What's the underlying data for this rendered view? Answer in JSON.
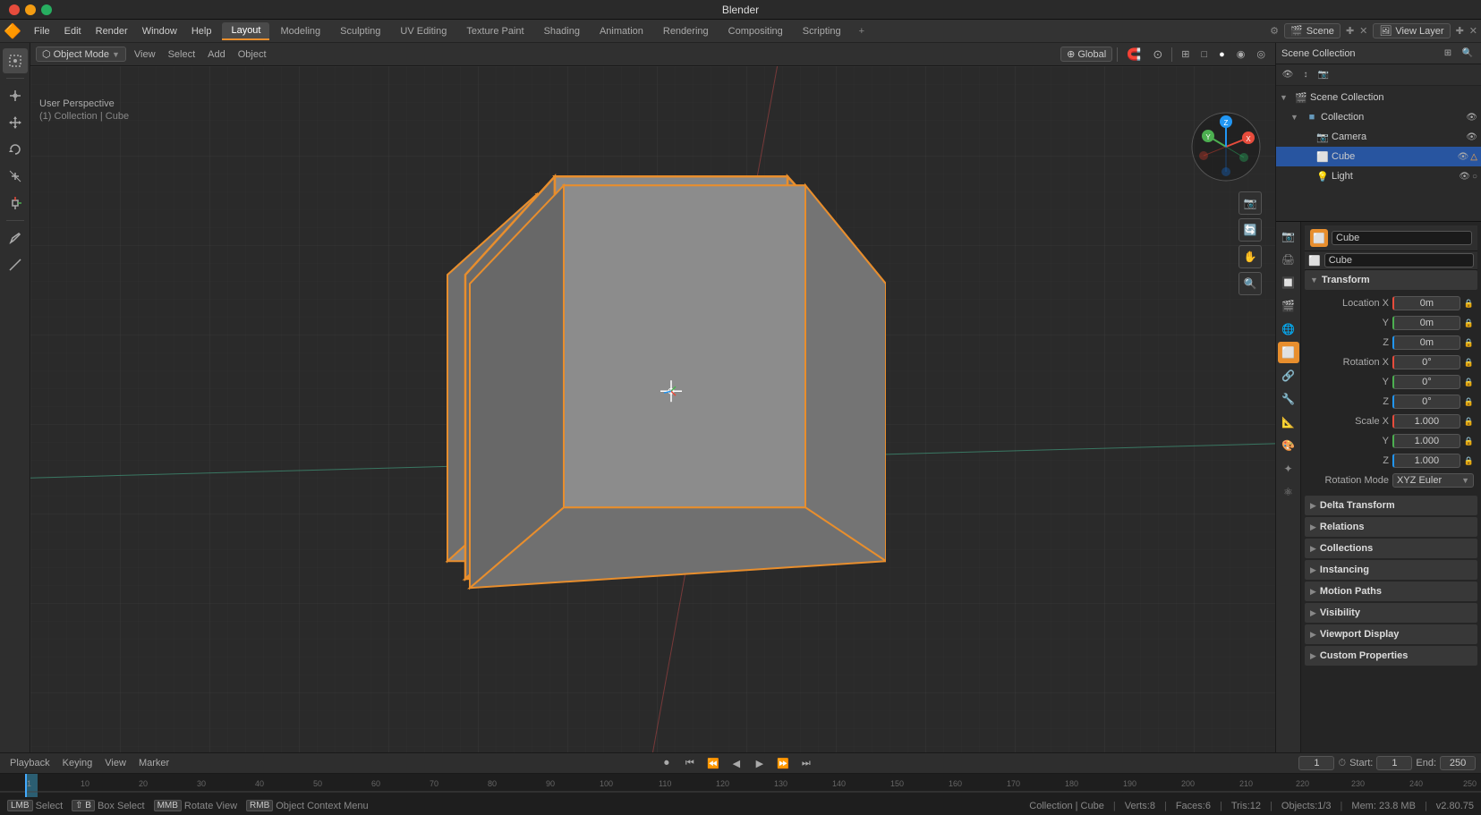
{
  "window": {
    "title": "Blender",
    "controls": [
      "close",
      "minimize",
      "maximize"
    ]
  },
  "menubar": {
    "menus": [
      "File",
      "Edit",
      "Render",
      "Window",
      "Help"
    ],
    "workspaces": [
      {
        "label": "Layout",
        "active": true
      },
      {
        "label": "Modeling"
      },
      {
        "label": "Sculpting"
      },
      {
        "label": "UV Editing"
      },
      {
        "label": "Texture Paint"
      },
      {
        "label": "Shading"
      },
      {
        "label": "Animation"
      },
      {
        "label": "Rendering"
      },
      {
        "label": "Compositing"
      },
      {
        "label": "Scripting"
      }
    ],
    "plus_label": "+",
    "scene_label": "Scene",
    "view_layer_label": "View Layer"
  },
  "viewport_header": {
    "mode": "Object Mode",
    "view": "View",
    "select": "Select",
    "add": "Add",
    "object": "Object",
    "transform": "Global"
  },
  "viewport": {
    "label1": "User Perspective",
    "label2": "(1) Collection | Cube"
  },
  "outliner": {
    "title": "Scene Collection",
    "items": [
      {
        "name": "Scene Collection",
        "level": 0,
        "expanded": true,
        "icon": "📁",
        "type": "collection"
      },
      {
        "name": "Collection",
        "level": 1,
        "expanded": true,
        "icon": "📂",
        "type": "collection"
      },
      {
        "name": "Camera",
        "level": 2,
        "icon": "📷",
        "type": "camera",
        "selected": false
      },
      {
        "name": "Cube",
        "level": 2,
        "icon": "⬜",
        "type": "mesh",
        "selected": true
      },
      {
        "name": "Light",
        "level": 2,
        "icon": "💡",
        "type": "light",
        "selected": false
      }
    ]
  },
  "properties": {
    "object_name": "Cube",
    "sections": {
      "transform_title": "Transform",
      "location_label": "Location",
      "location_x": "0m",
      "location_y": "0m",
      "location_z": "0m",
      "rotation_label": "Rotation",
      "rotation_x": "0°",
      "rotation_y": "0°",
      "rotation_z": "0°",
      "scale_label": "Scale",
      "scale_x": "1.000",
      "scale_y": "1.000",
      "scale_z": "1.000",
      "rotation_mode_label": "Rotation Mode",
      "rotation_mode_value": "XYZ Euler",
      "delta_transform": "Delta Transform",
      "relations": "Relations",
      "collections": "Collections",
      "instancing": "Instancing",
      "motion_paths": "Motion Paths",
      "visibility": "Visibility",
      "viewport_display": "Viewport Display",
      "custom_properties": "Custom Properties"
    }
  },
  "timeline": {
    "frame_current": "1",
    "frame_start": "1",
    "frame_end": "250",
    "start_label": "Start:",
    "end_label": "End:",
    "playback_label": "Playback",
    "keying_label": "Keying",
    "view_label": "View",
    "marker_label": "Marker",
    "marks": [
      "1",
      "10",
      "20",
      "30",
      "40",
      "50",
      "60",
      "70",
      "80",
      "90",
      "100",
      "110",
      "120",
      "130",
      "140",
      "150",
      "160",
      "170",
      "180",
      "190",
      "200",
      "210",
      "220",
      "230",
      "240",
      "250"
    ]
  },
  "status_bar": {
    "select_label": "Select",
    "box_select_label": "Box Select",
    "rotate_view_label": "Rotate View",
    "context_menu_label": "Object Context Menu",
    "collection_label": "Collection | Cube",
    "verts": "Verts:8",
    "faces": "Faces:6",
    "tris": "Tris:12",
    "objects": "Objects:1/3",
    "mem": "Mem: 23.8 MB",
    "version": "v2.80.75"
  },
  "icons": {
    "expand": "▶",
    "expanded": "▼",
    "eye": "👁",
    "lock": "🔒",
    "filter": "⊞",
    "close": "✕",
    "menu_icon": "☰"
  }
}
